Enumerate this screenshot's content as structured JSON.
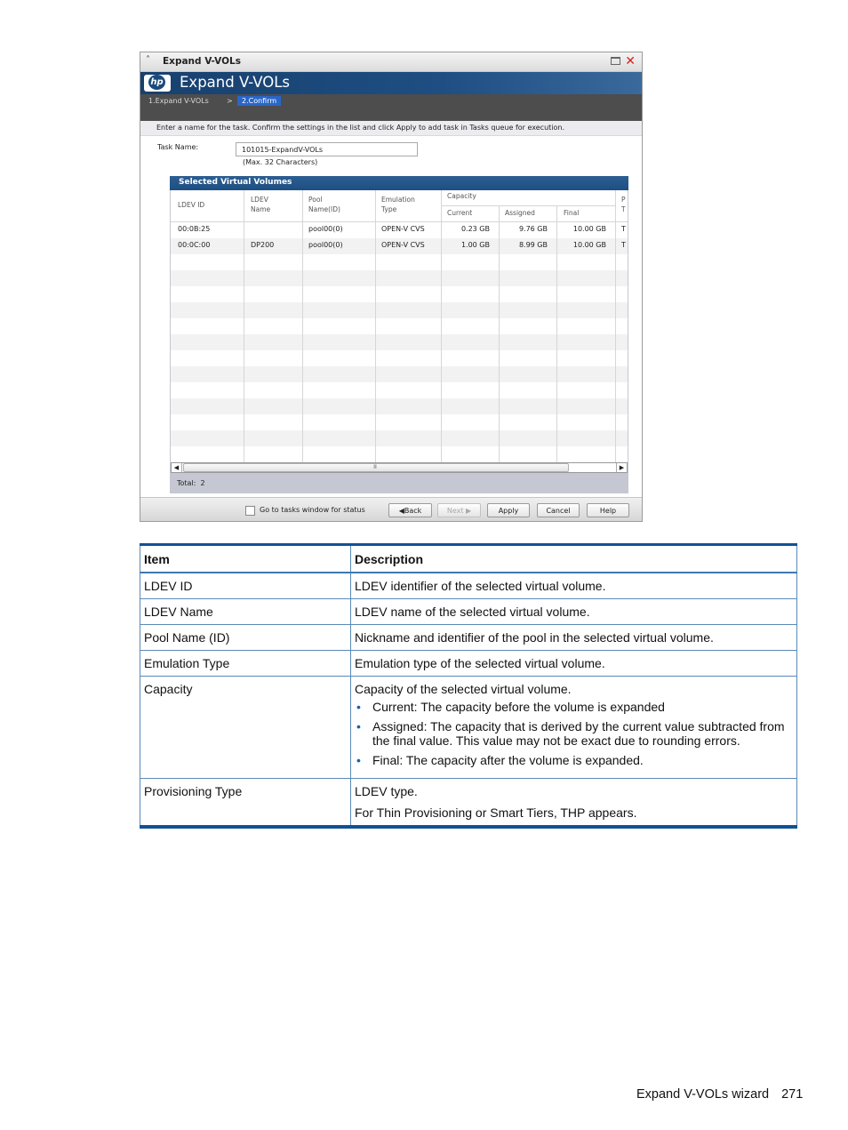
{
  "window": {
    "title": "Expand V-VOLs",
    "banner_title": "Expand V-VOLs",
    "logo_text": "hp",
    "icons": {
      "collapse": "double-chevron-up-icon",
      "maximize": "maximize-icon",
      "close": "close-icon"
    }
  },
  "steps": [
    {
      "label": "1.Expand V-VOLs",
      "active": false
    },
    {
      "label": "2.Confirm",
      "active": true
    }
  ],
  "step_separator": ">",
  "instruction": "Enter a name for the task. Confirm the settings in the list and click Apply to add task in Tasks queue for execution.",
  "task_name": {
    "label": "Task Name:",
    "value": "101015-ExpandV-VOLs",
    "hint": "(Max. 32 Characters)"
  },
  "selected_volumes": {
    "title": "Selected Virtual Volumes",
    "headers": {
      "ldev_id": "LDEV ID",
      "ldev_name_1": "LDEV",
      "ldev_name_2": "Name",
      "pool_1": "Pool",
      "pool_2": "Name(ID)",
      "emu_1": "Emulation",
      "emu_2": "Type",
      "capacity": "Capacity",
      "current": "Current",
      "assigned": "Assigned",
      "final": "Final",
      "prov_1": "P",
      "prov_2": "T"
    },
    "rows": [
      {
        "ldev_id": "00:0B:25",
        "ldev_name": "",
        "pool": "pool00(0)",
        "emulation": "OPEN-V CVS",
        "current": "0.23 GB",
        "assigned": "9.76 GB",
        "final": "10.00 GB",
        "prov": "T"
      },
      {
        "ldev_id": "00:0C:00",
        "ldev_name": "DP200",
        "pool": "pool00(0)",
        "emulation": "OPEN-V CVS",
        "current": "1.00 GB",
        "assigned": "8.99 GB",
        "final": "10.00 GB",
        "prov": "T"
      }
    ],
    "total_label": "Total:",
    "total_value": "2",
    "scroll_grip": "IIII"
  },
  "footer": {
    "checkbox_label": "Go to tasks window for status",
    "checkbox_checked": false,
    "back": "Back",
    "next": "Next",
    "apply": "Apply",
    "cancel": "Cancel",
    "help": "Help"
  },
  "doc_table": {
    "headers": [
      "Item",
      "Description"
    ],
    "rows": [
      {
        "item": "LDEV ID",
        "desc": "LDEV identifier of the selected virtual volume."
      },
      {
        "item": "LDEV Name",
        "desc": "LDEV name of the selected virtual volume."
      },
      {
        "item": "Pool Name (ID)",
        "desc": "Nickname and identifier of the pool in the selected virtual volume."
      },
      {
        "item": "Emulation Type",
        "desc": "Emulation type of the selected virtual volume."
      },
      {
        "item": "Capacity",
        "desc": "Capacity of the selected virtual volume.",
        "bullets": [
          "Current: The capacity before the volume is expanded",
          "Assigned: The capacity that is derived by the current value subtracted from the final value. This value may not be exact due to rounding errors.",
          "Final: The capacity after the volume is expanded."
        ]
      },
      {
        "item": "Provisioning Type",
        "desc": "LDEV type.",
        "desc2": "For Thin Provisioning or Smart Tiers, THP appears."
      }
    ]
  },
  "page_footer": {
    "section": "Expand V-VOLs wizard",
    "page_number": "271"
  }
}
